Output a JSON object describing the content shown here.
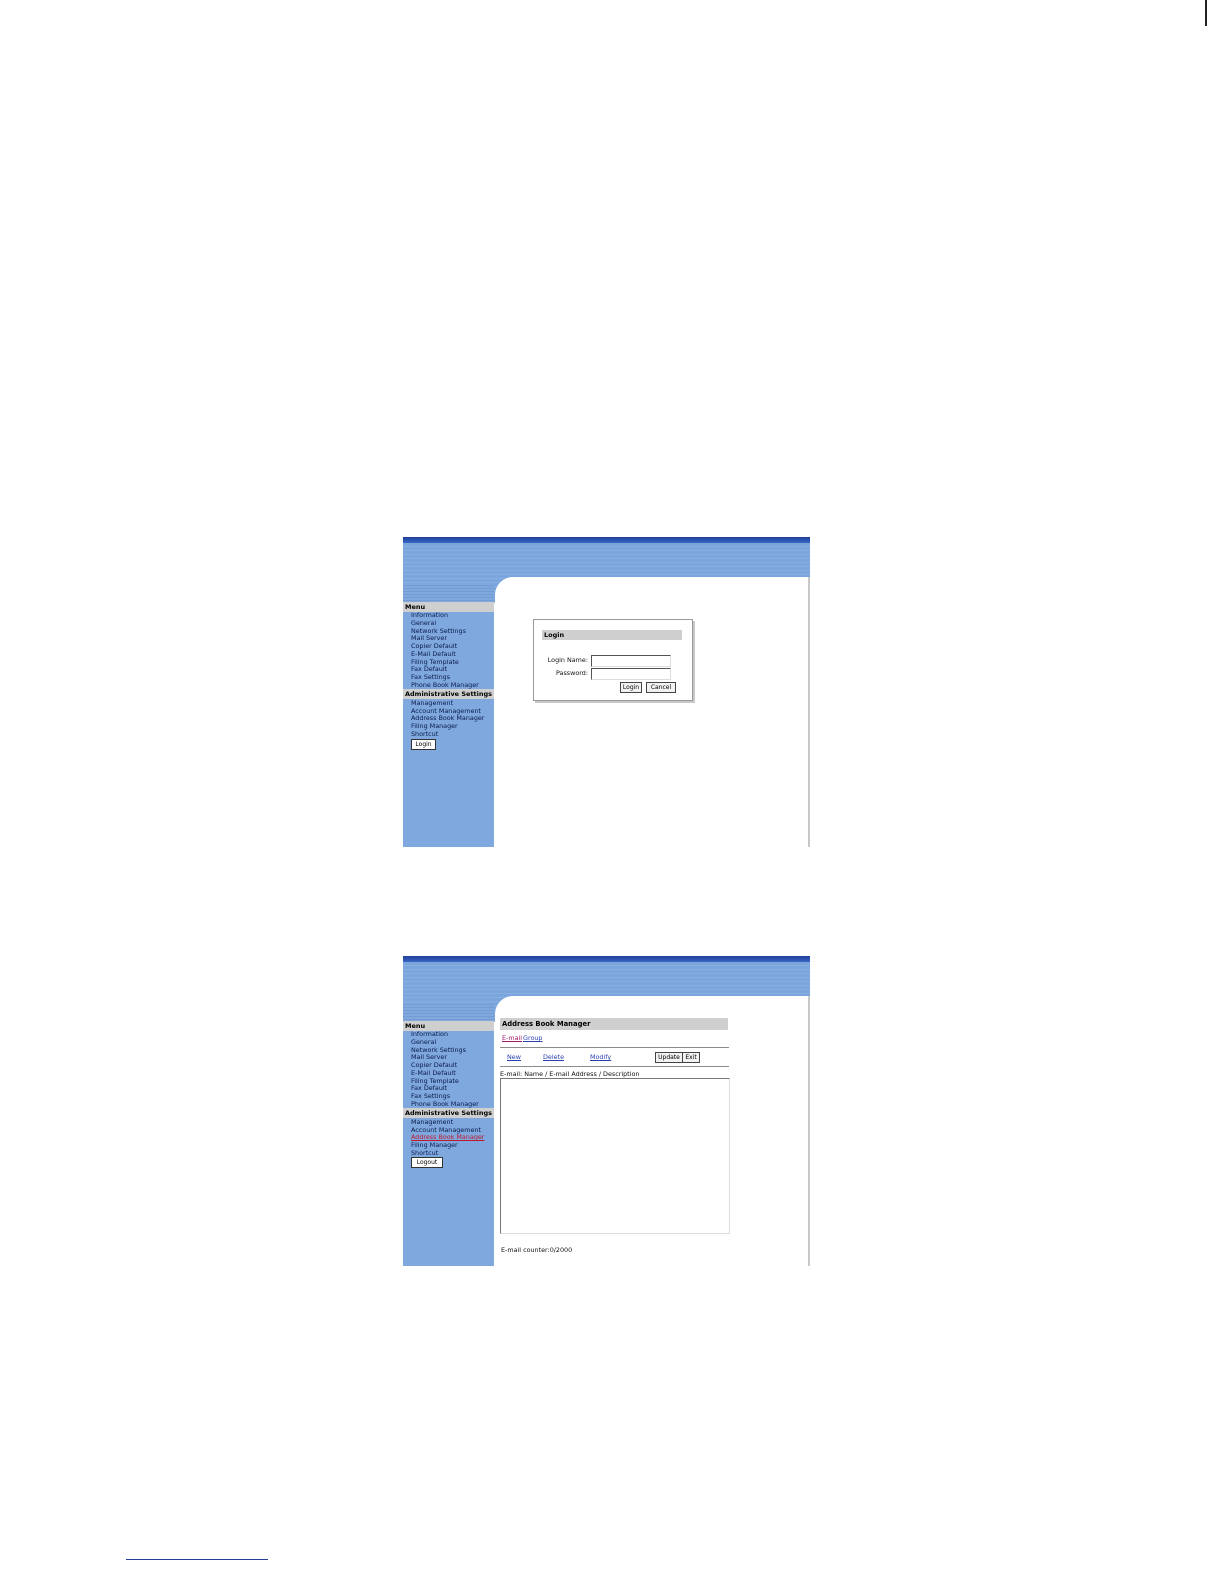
{
  "menu": {
    "header": "Menu",
    "items": [
      "Information",
      "General",
      "Network Settings",
      "Mail Server",
      "Copier Default",
      "E-Mail Default",
      "Filing Template",
      "Fax Default",
      "Fax Settings",
      "Phone Book Manager"
    ]
  },
  "admin": {
    "header": "Administrative Settings",
    "items": [
      "Management",
      "Account Management",
      "Address Book Manager",
      "Filing Manager",
      "Shortcut"
    ]
  },
  "screen1": {
    "sidebar_button": "Login",
    "dialog": {
      "title": "Login",
      "login_name_label": "Login Name:",
      "password_label": "Password:",
      "login_name_value": "",
      "password_value": "",
      "login_button": "Login",
      "cancel_button": "Cancel"
    }
  },
  "screen2": {
    "sidebar_button": "Logout",
    "active_admin_item": "Address Book Manager",
    "title": "Address Book Manager",
    "tabs": [
      "E-mail",
      "Group"
    ],
    "actions": [
      "New",
      "Delete",
      "Modify"
    ],
    "update_button": "Update",
    "exit_button": "Exit",
    "list_header": "E-mail: Name / E-mail Address / Description",
    "counter": "E-mail counter:0/2000"
  },
  "colors": {
    "topbar": "#1f3f9a",
    "banner": "#7ba6dd",
    "sidebar": "#7ea8de",
    "section_header": "#cfcfcf",
    "link": "#2a3fb0",
    "active_link": "#c0182a"
  }
}
